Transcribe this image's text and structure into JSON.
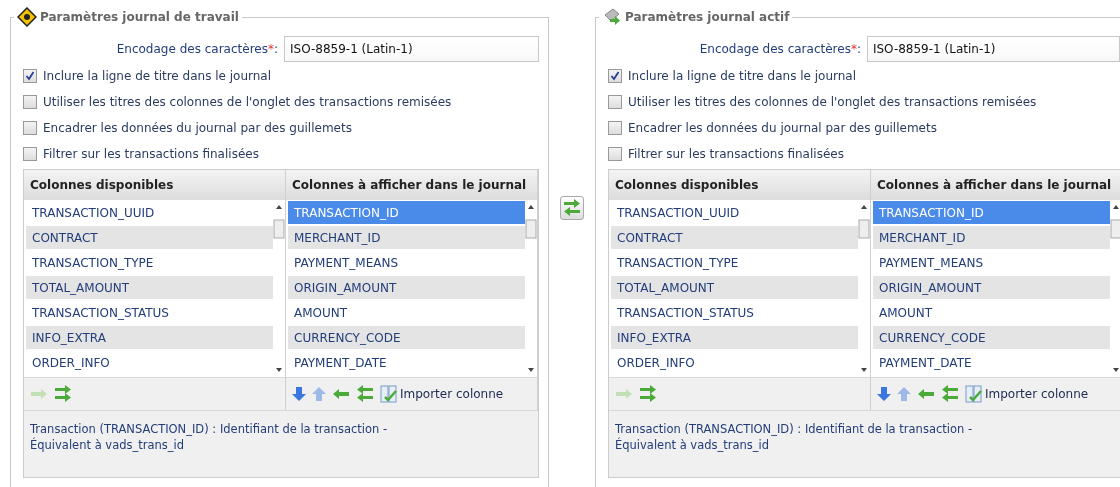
{
  "panels": [
    {
      "title": "Paramètres journal de travail",
      "encoding": {
        "label": "Encodage des caractères",
        "required_mark": "*",
        "separator": ":",
        "value": "ISO-8859-1 (Latin-1)"
      },
      "options": [
        {
          "label": "Inclure la ligne de titre dans le journal",
          "checked": true
        },
        {
          "label": "Utiliser les titres des colonnes de l'onglet des transactions remisées",
          "checked": false
        },
        {
          "label": "Encadrer les données du journal par des guillemets",
          "checked": false
        },
        {
          "label": "Filtrer sur les transactions finalisées",
          "checked": false
        }
      ],
      "available": {
        "header": "Colonnes disponibles",
        "items": [
          {
            "label": "TRANSACTION_UUID",
            "selected": false
          },
          {
            "label": "CONTRACT",
            "selected": false
          },
          {
            "label": "TRANSACTION_TYPE",
            "selected": false
          },
          {
            "label": "TOTAL_AMOUNT",
            "selected": false
          },
          {
            "label": "TRANSACTION_STATUS",
            "selected": false
          },
          {
            "label": "INFO_EXTRA",
            "selected": false
          },
          {
            "label": "ORDER_INFO",
            "selected": false
          }
        ],
        "tools": [
          {
            "kind": "add",
            "disabled": true
          },
          {
            "kind": "add_all",
            "disabled": false
          }
        ]
      },
      "displayed": {
        "header": "Colonnes à afficher dans le journal",
        "items": [
          {
            "label": "TRANSACTION_ID",
            "selected": true
          },
          {
            "label": "MERCHANT_ID",
            "selected": false
          },
          {
            "label": "PAYMENT_MEANS",
            "selected": false
          },
          {
            "label": "ORIGIN_AMOUNT",
            "selected": false
          },
          {
            "label": "AMOUNT",
            "selected": false
          },
          {
            "label": "CURRENCY_CODE",
            "selected": false
          },
          {
            "label": "PAYMENT_DATE",
            "selected": false
          }
        ],
        "tools": [
          {
            "kind": "down",
            "disabled": false
          },
          {
            "kind": "up",
            "disabled": true
          },
          {
            "kind": "remove",
            "disabled": false
          },
          {
            "kind": "remove_all",
            "disabled": false
          },
          {
            "kind": "import",
            "disabled": false,
            "label": "Importer colonne"
          }
        ]
      },
      "description": [
        "Transaction (TRANSACTION_ID) : Identifiant de la transaction -",
        "Équivalent à vads_trans_id"
      ]
    },
    {
      "title": "Paramètres journal actif",
      "encoding": {
        "label": "Encodage des caractères",
        "required_mark": "*",
        "separator": ":",
        "value": "ISO-8859-1 (Latin-1)"
      },
      "options": [
        {
          "label": "Inclure la ligne de titre dans le journal",
          "checked": true
        },
        {
          "label": "Utiliser les titres des colonnes de l'onglet des transactions remisées",
          "checked": false
        },
        {
          "label": "Encadrer les données du journal par des guillemets",
          "checked": false
        },
        {
          "label": "Filtrer sur les transactions finalisées",
          "checked": false
        }
      ],
      "available": {
        "header": "Colonnes disponibles",
        "items": [
          {
            "label": "TRANSACTION_UUID",
            "selected": false
          },
          {
            "label": "CONTRACT",
            "selected": false
          },
          {
            "label": "TRANSACTION_TYPE",
            "selected": false
          },
          {
            "label": "TOTAL_AMOUNT",
            "selected": false
          },
          {
            "label": "TRANSACTION_STATUS",
            "selected": false
          },
          {
            "label": "INFO_EXTRA",
            "selected": false
          },
          {
            "label": "ORDER_INFO",
            "selected": false
          }
        ],
        "tools": [
          {
            "kind": "add",
            "disabled": true
          },
          {
            "kind": "add_all",
            "disabled": false
          }
        ]
      },
      "displayed": {
        "header": "Colonnes à afficher dans le journal",
        "items": [
          {
            "label": "TRANSACTION_ID",
            "selected": true
          },
          {
            "label": "MERCHANT_ID",
            "selected": false
          },
          {
            "label": "PAYMENT_MEANS",
            "selected": false
          },
          {
            "label": "ORIGIN_AMOUNT",
            "selected": false
          },
          {
            "label": "AMOUNT",
            "selected": false
          },
          {
            "label": "CURRENCY_CODE",
            "selected": false
          },
          {
            "label": "PAYMENT_DATE",
            "selected": false
          }
        ],
        "tools": [
          {
            "kind": "down",
            "disabled": false
          },
          {
            "kind": "up",
            "disabled": true
          },
          {
            "kind": "remove",
            "disabled": false
          },
          {
            "kind": "remove_all",
            "disabled": false
          },
          {
            "kind": "import",
            "disabled": false,
            "label": "Importer colonne"
          }
        ]
      },
      "description": [
        "Transaction (TRANSACTION_ID) : Identifiant de la transaction -",
        "Équivalent à vads_trans_id"
      ]
    }
  ]
}
